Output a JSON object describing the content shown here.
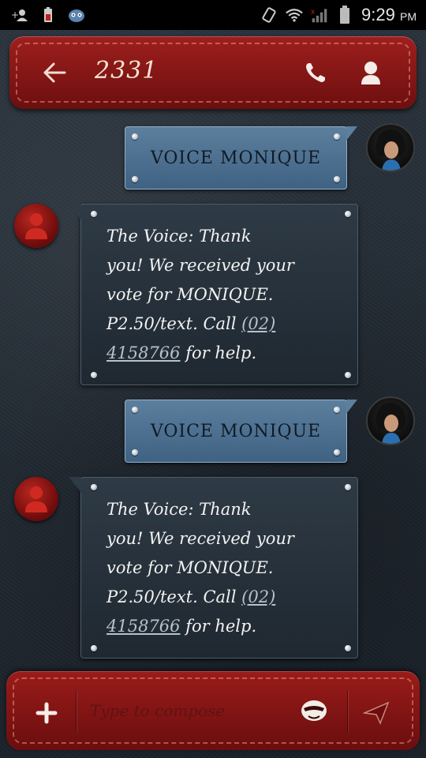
{
  "status_bar": {
    "time": "9:29",
    "ampm": "PM",
    "left_icons": [
      "add-contact-icon",
      "battery-saver-icon",
      "app-notification-icon"
    ],
    "right_icons": [
      "vibrate-icon",
      "wifi-icon",
      "signal-icon",
      "battery-icon"
    ]
  },
  "header": {
    "title": "2331",
    "back_icon": "arrow-left-icon",
    "call_icon": "phone-icon",
    "contact_icon": "person-icon"
  },
  "messages": [
    {
      "type": "sent",
      "text": "VOICE MONIQUE"
    },
    {
      "type": "received",
      "lines": [
        "The Voice: Thank",
        "you! We received your",
        "vote for MONIQUE.",
        "P2.50/text. Call "
      ],
      "link1": "(02)",
      "link2": "4158766",
      "tail": " for help."
    },
    {
      "type": "sent",
      "text": "VOICE MONIQUE"
    },
    {
      "type": "received",
      "lines": [
        "The Voice: Thank",
        "you! We received your",
        "vote for MONIQUE.",
        "P2.50/text. Call "
      ],
      "link1": "(02)",
      "link2": "4158766",
      "tail": " for help."
    }
  ],
  "compose": {
    "placeholder": "Type to compose",
    "attach_icon": "plus-icon",
    "emoji_icon": "smiley-icon",
    "send_icon": "send-icon"
  },
  "colors": {
    "header_red": "#8b1716",
    "sent_bubble": "#4d7092",
    "received_bubble": "#26313b",
    "background": "#1f2730"
  }
}
